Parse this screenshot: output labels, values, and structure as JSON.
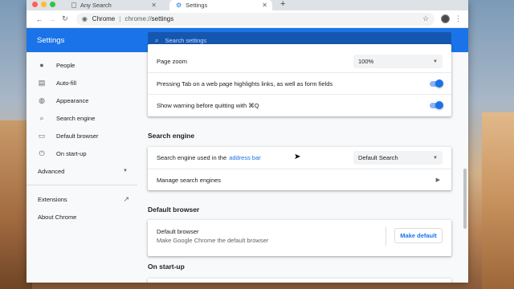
{
  "window": {
    "tabs": [
      {
        "label": "Any Search",
        "active": false
      },
      {
        "label": "Settings",
        "active": true
      }
    ],
    "omnibox": {
      "site": "Chrome",
      "scheme": "chrome://",
      "path": "settings"
    }
  },
  "header": {
    "title": "Settings",
    "search_placeholder": "Search settings"
  },
  "sidebar": {
    "items": [
      {
        "label": "People",
        "icon": "person-icon"
      },
      {
        "label": "Auto-fill",
        "icon": "clipboard-icon"
      },
      {
        "label": "Appearance",
        "icon": "palette-icon"
      },
      {
        "label": "Search engine",
        "icon": "search-icon"
      },
      {
        "label": "Default browser",
        "icon": "browser-icon"
      },
      {
        "label": "On start-up",
        "icon": "power-icon"
      }
    ],
    "advanced_label": "Advanced",
    "extensions_label": "Extensions",
    "about_label": "About Chrome"
  },
  "appearance": {
    "page_zoom_label": "Page zoom",
    "page_zoom_value": "100%",
    "tab_highlight_label": "Pressing Tab on a web page highlights links, as well as form fields",
    "quit_warning_label": "Show warning before quitting with ⌘Q"
  },
  "search_engine": {
    "section_title": "Search engine",
    "used_label": "Search engine used in the",
    "address_bar_link": "address bar",
    "selected": "Default Search",
    "manage_label": "Manage search engines"
  },
  "default_browser": {
    "section_title": "Default browser",
    "title": "Default browser",
    "subtitle": "Make Google Chrome the default browser",
    "button_label": "Make default"
  },
  "startup": {
    "section_title": "On start-up"
  },
  "colors": {
    "accent": "#1a73e8",
    "header_bg": "#1a73e8",
    "search_bg": "#1557b0"
  }
}
